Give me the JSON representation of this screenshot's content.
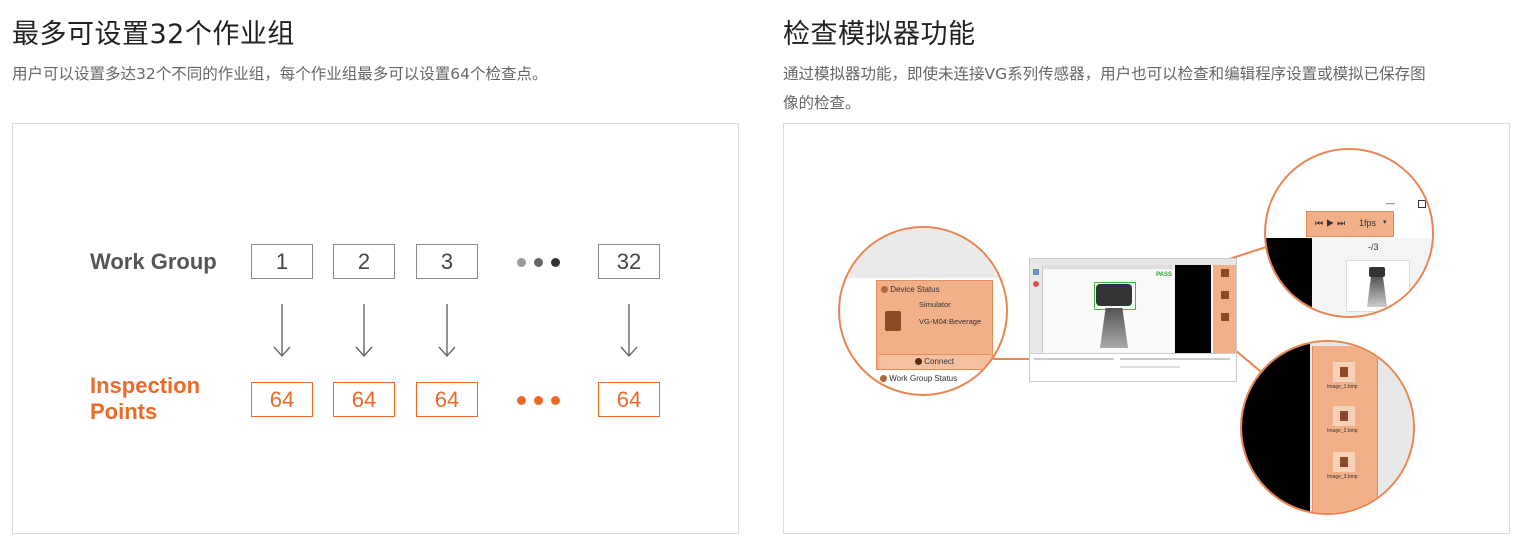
{
  "left": {
    "title": "最多可设置32个作业组",
    "desc": "用户可以设置多达32个不同的作业组，每个作业组最多可以设置64个检查点。",
    "diagram": {
      "work_group_label": "Work Group",
      "inspection_label_line1": "Inspection",
      "inspection_label_line2": "Points",
      "groups": [
        "1",
        "2",
        "3",
        "32"
      ],
      "points": [
        "64",
        "64",
        "64",
        "64"
      ]
    }
  },
  "right": {
    "title": "检查模拟器功能",
    "desc_line1": "通过模拟器功能，即使未连接VG系列传感器，用户也可以检查和编辑程序设置或模拟已保存图",
    "desc_line2": "像的检查。",
    "left_zoom": {
      "device_status": "Device Status",
      "simulator": "Simulator",
      "model": "VG-M04:Beverage",
      "connect": "Connect",
      "work_group_status": "Work Group Status"
    },
    "top_zoom": {
      "fps": "1fps",
      "page": "-/3"
    },
    "bottom_zoom": {
      "files": [
        "Image_1.bmp",
        "Image_2.bmp",
        "Image_3.bmp"
      ]
    },
    "window": {
      "pass_label": "PASS"
    }
  },
  "colors": {
    "accent_orange": "#ec6a25",
    "panel_orange": "#f2b088",
    "border_gray": "#dcdcdc"
  }
}
